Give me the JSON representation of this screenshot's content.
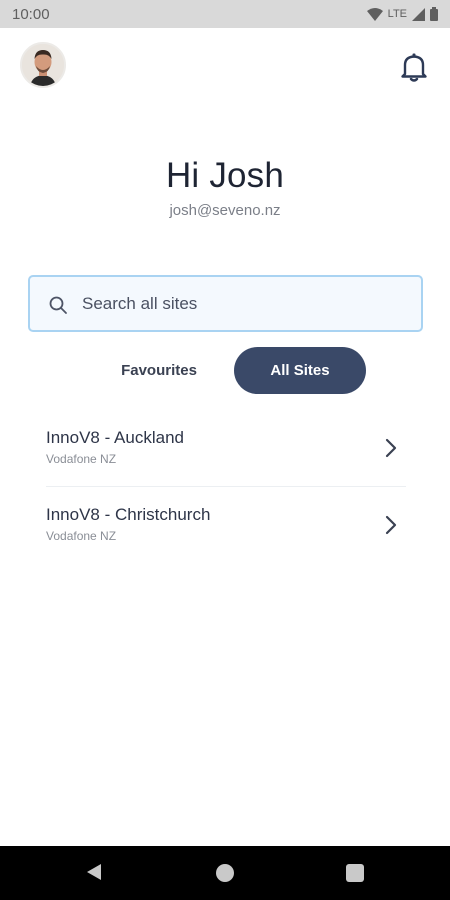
{
  "status_bar": {
    "time": "10:00",
    "network": "LTE"
  },
  "header": {
    "avatar": "user-avatar",
    "notification_icon": "bell-icon"
  },
  "greeting": {
    "title": "Hi Josh",
    "email": "josh@seveno.nz"
  },
  "search": {
    "placeholder": "Search all sites",
    "value": ""
  },
  "tabs": [
    {
      "label": "Favourites",
      "active": false
    },
    {
      "label": "All Sites",
      "active": true
    }
  ],
  "sites": [
    {
      "name": "InnoV8 - Auckland",
      "provider": "Vodafone NZ"
    },
    {
      "name": "InnoV8 - Christchurch",
      "provider": "Vodafone NZ"
    }
  ],
  "colors": {
    "accent": "#3a4968",
    "search_border": "#a9d3f2",
    "search_bg": "#f4f9fe"
  }
}
